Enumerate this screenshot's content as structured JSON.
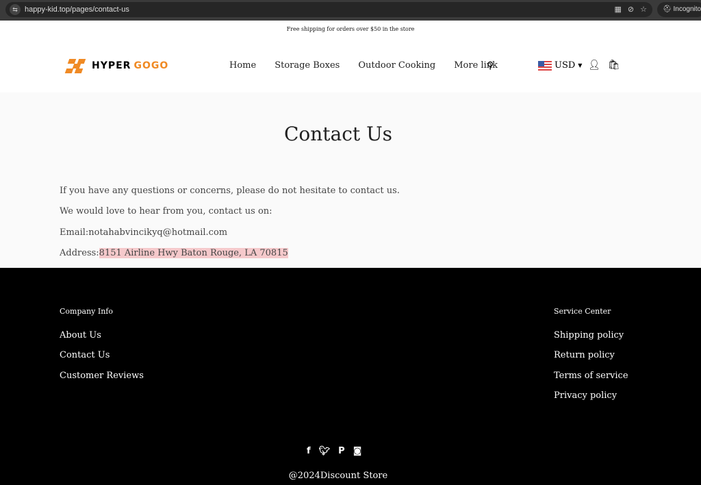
{
  "browser": {
    "url": "happy-kid.top/pages/contact-us",
    "incognito": "Incognito"
  },
  "announcement": "Free shipping for orders over $50 in the store",
  "logo": {
    "text1": "HYPER",
    "text2": "GOGO"
  },
  "nav": [
    "Home",
    "Storage Boxes",
    "Outdoor Cooking",
    "More link"
  ],
  "currency": "USD",
  "page": {
    "title": "Contact Us",
    "lines": [
      "If you have any questions or concerns, please do not hesitate to contact us.",
      "We would love to hear from you, contact us on:",
      "Email:notahabvincikyq@hotmail.com"
    ],
    "address_label": "Address:",
    "address": "8151 Airline Hwy Baton Rouge, LA 70815"
  },
  "footer": {
    "company_heading": "Company Info",
    "company_links": [
      "About Us",
      "Contact Us",
      "Customer Reviews"
    ],
    "service_heading": "Service Center",
    "service_links": [
      "Shipping policy",
      "Return policy",
      "Terms of service",
      "Privacy policy"
    ],
    "copyright": "@2024Discount Store"
  },
  "colors": {
    "accent": "#f08a24",
    "highlight": "#f5c9cb",
    "footer_bg": "#000000"
  }
}
